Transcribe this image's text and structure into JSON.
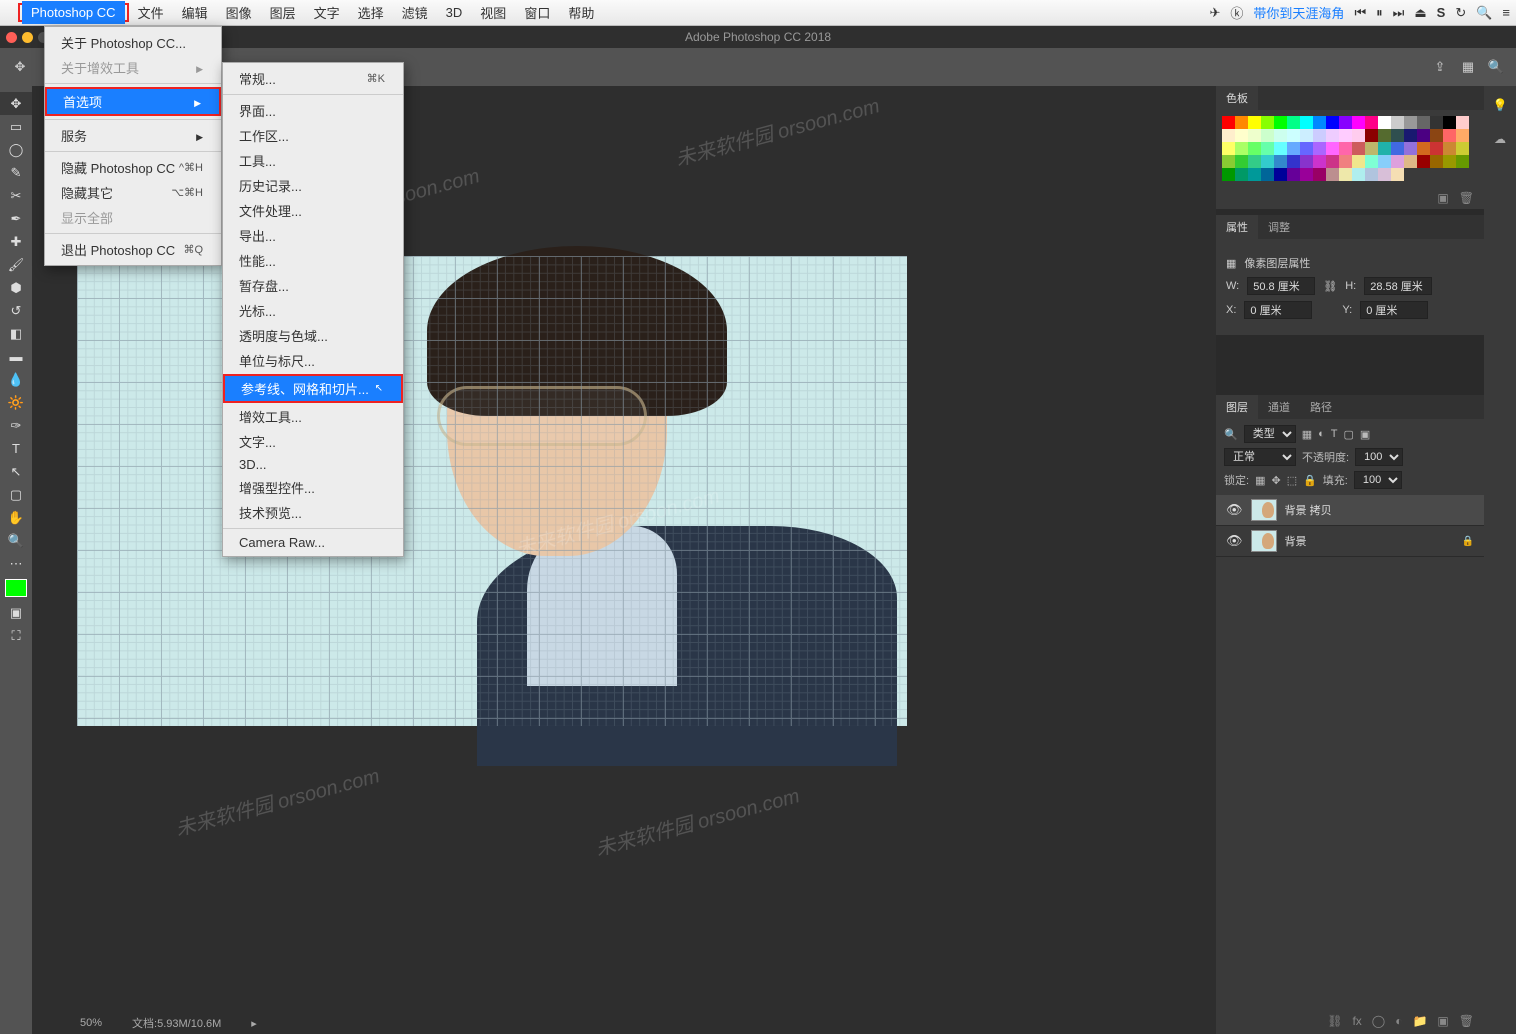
{
  "mac_menu": {
    "app": "Photoshop CC",
    "items": [
      "文件",
      "编辑",
      "图像",
      "图层",
      "文字",
      "选择",
      "滤镜",
      "3D",
      "视图",
      "窗口",
      "帮助"
    ],
    "right_text": "带你到天涯海角",
    "right_icons": [
      "send-icon",
      "token-icon"
    ],
    "media_icons": [
      "prev-icon",
      "pause-icon",
      "next-icon",
      "eject-icon",
      "s-icon",
      "refresh-icon",
      "search-icon",
      "menu-icon"
    ]
  },
  "window_title": "Adobe Photoshop CC 2018",
  "dropdown_main": {
    "items": [
      {
        "label": "关于 Photoshop CC...",
        "enabled": true
      },
      {
        "label": "关于增效工具",
        "enabled": false,
        "arrow": true
      },
      {
        "label": "首选项",
        "selected": true,
        "arrow": true,
        "boxed": true
      },
      {
        "label": "服务",
        "arrow": true
      },
      {
        "label": "隐藏 Photoshop CC",
        "shortcut": "^⌘H"
      },
      {
        "label": "隐藏其它",
        "shortcut": "⌥⌘H"
      },
      {
        "label": "显示全部",
        "enabled": false
      },
      {
        "label": "退出 Photoshop CC",
        "shortcut": "⌘Q"
      }
    ]
  },
  "dropdown_prefs": {
    "items": [
      {
        "label": "常规...",
        "shortcut": "⌘K"
      },
      {
        "sep": true
      },
      {
        "label": "界面..."
      },
      {
        "label": "工作区..."
      },
      {
        "label": "工具..."
      },
      {
        "label": "历史记录..."
      },
      {
        "label": "文件处理..."
      },
      {
        "label": "导出..."
      },
      {
        "label": "性能..."
      },
      {
        "label": "暂存盘..."
      },
      {
        "label": "光标..."
      },
      {
        "label": "透明度与色域..."
      },
      {
        "label": "单位与标尺..."
      },
      {
        "label": "参考线、网格和切片...",
        "selected": true,
        "boxed": true
      },
      {
        "label": "增效工具..."
      },
      {
        "label": "文字..."
      },
      {
        "label": "3D..."
      },
      {
        "label": "增强型控件..."
      },
      {
        "label": "技术预览..."
      },
      {
        "sep": true
      },
      {
        "label": "Camera Raw..."
      }
    ]
  },
  "panels": {
    "swatches_tab": "色板",
    "properties_tab": "属性",
    "adjustments_tab": "调整",
    "properties_title": "像素图层属性",
    "w_label": "W:",
    "w_value": "50.8 厘米",
    "h_label": "H:",
    "h_value": "28.58 厘米",
    "x_label": "X:",
    "x_value": "0 厘米",
    "y_label": "Y:",
    "y_value": "0 厘米",
    "layers_tab": "图层",
    "channels_tab": "通道",
    "paths_tab": "路径",
    "kind_label": "类型",
    "blend_mode": "正常",
    "opacity_label": "不透明度:",
    "opacity_value": "100%",
    "lock_label": "锁定:",
    "fill_label": "填充:",
    "fill_value": "100%",
    "layer1": "背景 拷贝",
    "layer2": "背景"
  },
  "status": {
    "zoom": "50%",
    "doc": "文档:5.93M/10.6M"
  },
  "swatch_colors": [
    "#ff0000",
    "#ff8800",
    "#ffff00",
    "#88ff00",
    "#00ff00",
    "#00ff88",
    "#00ffff",
    "#0088ff",
    "#0000ff",
    "#8800ff",
    "#ff00ff",
    "#ff0088",
    "#ffffff",
    "#cccccc",
    "#999999",
    "#666666",
    "#333333",
    "#000000",
    "#ffcccc",
    "#ffeecc",
    "#ffffcc",
    "#eeffcc",
    "#ccffcc",
    "#ccffee",
    "#ccffff",
    "#cceeff",
    "#ccccff",
    "#eeccff",
    "#ffccff",
    "#ffccee",
    "#8b0000",
    "#556b2f",
    "#2f4f4f",
    "#191970",
    "#4b0082",
    "#8b4513",
    "#ff6666",
    "#ffaa66",
    "#ffff66",
    "#aaff66",
    "#66ff66",
    "#66ffaa",
    "#66ffff",
    "#66aaff",
    "#6666ff",
    "#aa66ff",
    "#ff66ff",
    "#ff66aa",
    "#cd5c5c",
    "#bdb76b",
    "#20b2aa",
    "#4169e1",
    "#9370db",
    "#d2691e",
    "#cc3333",
    "#cc8833",
    "#cccc33",
    "#88cc33",
    "#33cc33",
    "#33cc88",
    "#33cccc",
    "#3388cc",
    "#3333cc",
    "#8833cc",
    "#cc33cc",
    "#cc3388",
    "#f08080",
    "#f0e68c",
    "#7fffd4",
    "#87cefa",
    "#dda0dd",
    "#deb887",
    "#990000",
    "#996600",
    "#999900",
    "#669900",
    "#009900",
    "#009966",
    "#009999",
    "#006699",
    "#000099",
    "#660099",
    "#990099",
    "#990066",
    "#bc8f8f",
    "#eee8aa",
    "#afeeee",
    "#b0c4de",
    "#d8bfd8",
    "#f5deb3"
  ]
}
